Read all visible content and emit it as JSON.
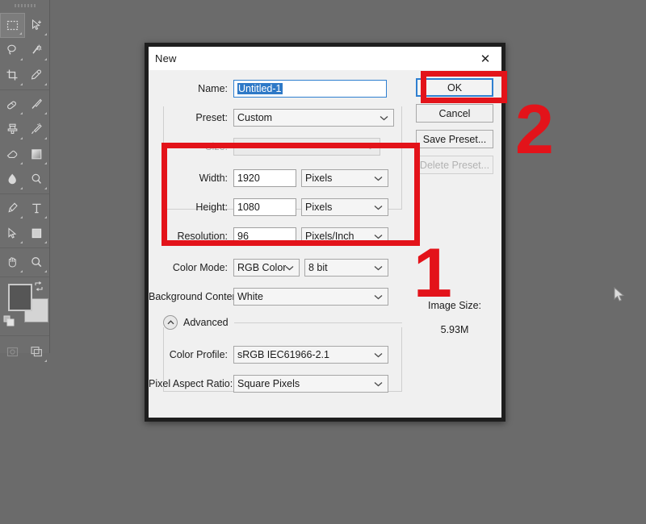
{
  "app": {
    "background_color": "#6b6b6b",
    "toolbar_color": "#6e6e6e"
  },
  "toolbox": {
    "name": "photoshop-toolbox",
    "groups": [
      {
        "tools": [
          {
            "icon": "rectangular-marquee-icon",
            "active": true
          },
          {
            "icon": "move-icon",
            "active": false
          },
          {
            "icon": "lasso-icon",
            "active": false
          },
          {
            "icon": "magic-wand-icon",
            "active": false
          },
          {
            "icon": "crop-icon",
            "active": false
          },
          {
            "icon": "eyedropper-icon",
            "active": false
          }
        ]
      },
      {
        "tools": [
          {
            "icon": "healing-brush-icon",
            "active": false
          },
          {
            "icon": "brush-icon",
            "active": false
          },
          {
            "icon": "clone-stamp-icon",
            "active": false
          },
          {
            "icon": "history-brush-icon",
            "active": false
          },
          {
            "icon": "eraser-icon",
            "active": false
          },
          {
            "icon": "gradient-icon",
            "active": false
          },
          {
            "icon": "blur-icon",
            "active": false
          },
          {
            "icon": "dodge-icon",
            "active": false
          }
        ]
      },
      {
        "tools": [
          {
            "icon": "pen-icon",
            "active": false
          },
          {
            "icon": "type-icon",
            "active": false
          },
          {
            "icon": "path-selection-icon",
            "active": false
          },
          {
            "icon": "rectangle-shape-icon",
            "active": false
          }
        ]
      },
      {
        "tools": [
          {
            "icon": "hand-icon",
            "active": false
          },
          {
            "icon": "zoom-icon",
            "active": false
          }
        ]
      }
    ],
    "swatches": {
      "foreground_color": "#565656",
      "background_color": "#d4d4d4",
      "swap_icon": "swap-colors-icon",
      "default_icon": "default-colors-icon"
    },
    "mode_tools": [
      {
        "icon": "quick-mask-icon"
      },
      {
        "icon": "screen-mode-icon"
      }
    ]
  },
  "dialog": {
    "title": "New",
    "close_icon": "close-icon",
    "name": {
      "label": "Name:",
      "value": "Untitled-1",
      "selected": true
    },
    "preset": {
      "label": "Preset:",
      "value": "Custom",
      "chevron_icon": "chevron-down-icon"
    },
    "size": {
      "label": "Size:",
      "value": "",
      "disabled": true,
      "chevron_icon": "chevron-down-icon"
    },
    "width": {
      "label": "Width:",
      "value": "1920",
      "unit": "Pixels",
      "chevron_icon": "chevron-down-icon"
    },
    "height": {
      "label": "Height:",
      "value": "1080",
      "unit": "Pixels",
      "chevron_icon": "chevron-down-icon"
    },
    "resolution": {
      "label": "Resolution:",
      "value": "96",
      "unit": "Pixels/Inch",
      "chevron_icon": "chevron-down-icon"
    },
    "color_mode": {
      "label": "Color Mode:",
      "value": "RGB Color",
      "depth": "8 bit",
      "chevron_icon": "chevron-down-icon"
    },
    "background_contents": {
      "label": "Background Contents:",
      "value": "White",
      "chevron_icon": "chevron-down-icon"
    },
    "advanced": {
      "label": "Advanced",
      "toggle_icon": "chevron-up-icon",
      "expanded": true
    },
    "color_profile": {
      "label": "Color Profile:",
      "value": "sRGB IEC61966-2.1",
      "chevron_icon": "chevron-down-icon"
    },
    "pixel_aspect_ratio": {
      "label": "Pixel Aspect Ratio:",
      "value": "Square Pixels",
      "chevron_icon": "chevron-down-icon"
    },
    "buttons": {
      "ok": "OK",
      "cancel": "Cancel",
      "save_preset": "Save Preset...",
      "delete_preset": "Delete Preset..."
    },
    "image_size": {
      "label": "Image Size:",
      "value": "5.93M"
    }
  },
  "annotations": {
    "color": "#e3131a",
    "marker_one": "1",
    "marker_two": "2"
  },
  "cursor": {
    "icon": "mouse-pointer-icon"
  }
}
